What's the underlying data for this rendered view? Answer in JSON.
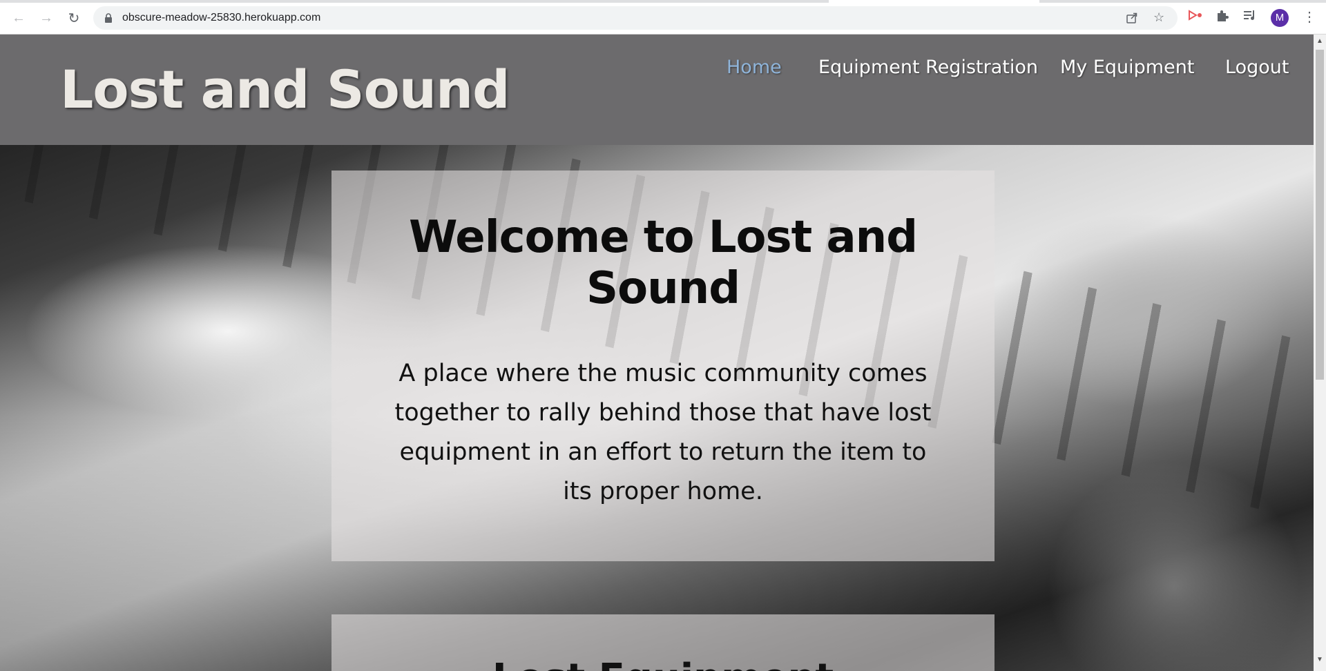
{
  "browser": {
    "url": "obscure-meadow-25830.herokuapp.com",
    "avatar_initial": "M"
  },
  "site": {
    "brand": "Lost and Sound",
    "nav": [
      {
        "label": "Home",
        "active": true
      },
      {
        "label": "Equipment Registration",
        "active": false
      },
      {
        "label": "My Equipment",
        "active": false
      },
      {
        "label": "Logout",
        "active": false
      }
    ]
  },
  "hero": {
    "title": "Welcome to Lost and Sound",
    "description": "A place where the music community comes together to rally behind those that have lost equipment in an effort to return the item to its proper home."
  },
  "section2": {
    "title": "Lost Equipment"
  },
  "colors": {
    "header_bg": "#6c6b6d",
    "nav_active": "#8fb4d9",
    "brand_text": "#ece9e4"
  }
}
